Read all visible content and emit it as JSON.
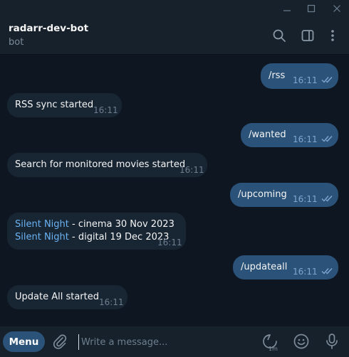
{
  "window_controls": {
    "minimize": "minimize-icon",
    "maximize": "maximize-icon",
    "close": "close-icon"
  },
  "header": {
    "title": "radarr-dev-bot",
    "status": "bot",
    "icons": [
      "search-icon",
      "sidebar-panel-icon",
      "more-vertical-icon"
    ]
  },
  "messages": [
    {
      "dir": "out",
      "text": "/rss",
      "time": "16:11",
      "read": true
    },
    {
      "dir": "in",
      "text": "RSS sync started",
      "time": "16:11"
    },
    {
      "dir": "out",
      "text": "/wanted",
      "time": "16:11",
      "read": true
    },
    {
      "dir": "in",
      "text": "Search for monitored movies started",
      "time": "16:11"
    },
    {
      "dir": "out",
      "text": "/upcoming",
      "time": "16:11",
      "read": true
    },
    {
      "dir": "in",
      "lines": [
        {
          "link": "Silent Night",
          "rest": " - cinema 30 Nov 2023"
        },
        {
          "link": "Silent Night",
          "rest": " - digital 19 Dec 2023"
        }
      ],
      "time": "16:11"
    },
    {
      "dir": "out",
      "text": "/updateall",
      "time": "16:11",
      "read": true
    },
    {
      "dir": "in",
      "text": "Update All started",
      "time": "16:11"
    }
  ],
  "composer": {
    "menu_label": "Menu",
    "placeholder": "Write a message...",
    "timer_label": "1m",
    "icons": [
      "attach-icon",
      "timer-icon",
      "emoji-icon",
      "microphone-icon"
    ]
  },
  "colors": {
    "background": "#0e1621",
    "panel": "#17212b",
    "outgoing_bubble": "#2b5278",
    "incoming_bubble": "#182533",
    "link": "#6ab3f3",
    "read_ticks": "#7da8d3"
  }
}
